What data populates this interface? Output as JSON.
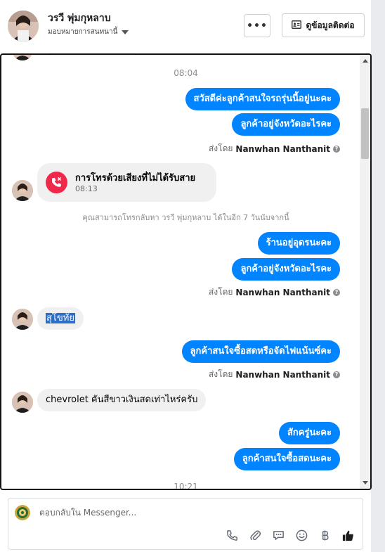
{
  "header": {
    "contact_name": "วรวี พุ่มกุหลาบ",
    "assign_label": "มอบหมายการสนทนานี้",
    "more_label": "•••",
    "contact_info_label": "ดูข้อมูลติดต่อ"
  },
  "chat": {
    "timestamp_1": "08:04",
    "msg_1": "สวัสดีค่ะลูกค้าสนใจรถรุ่นนี้อยู่นะคะ",
    "msg_2": "ลูกค้าอยู่จังหวัดอะไรคะ",
    "sent_by_prefix": "ส่งโดย",
    "agent_name": "Nanwhan Nanthanit",
    "missed_call_title": "การโทรด้วยเสียงที่ไม่ได้รับสาย",
    "missed_call_time": "08:13",
    "callback_note": "คุณสามารถโทรกลับหา วรวี พุ่มกุหลาบ ได้ในอีก 7 วันนับจากนี้",
    "msg_3": "ร้านอยู่อุดรนะคะ",
    "msg_4": "ลูกค้าอยู่จังหวัดอะไรคะ",
    "msg_5_customer": "สุโขทัย",
    "msg_6": "ลูกค้าสนใจซื้อสดหรือจัดไฟแน้นซ์คะ",
    "msg_7_customer": "chevrolet คันสีขาวเงินสดเท่าไหร่ครับ",
    "msg_8": "สักครู่นะคะ",
    "msg_9": "ลูกค้าสนใจซื้อสดนะคะ",
    "timestamp_2": "10:21"
  },
  "composer": {
    "placeholder": "ตอบกลับใน Messenger..."
  },
  "colors": {
    "outgoing_bubble": "#0084ff",
    "incoming_bubble": "#f0f0f0",
    "missed_call_icon": "#f02849"
  }
}
